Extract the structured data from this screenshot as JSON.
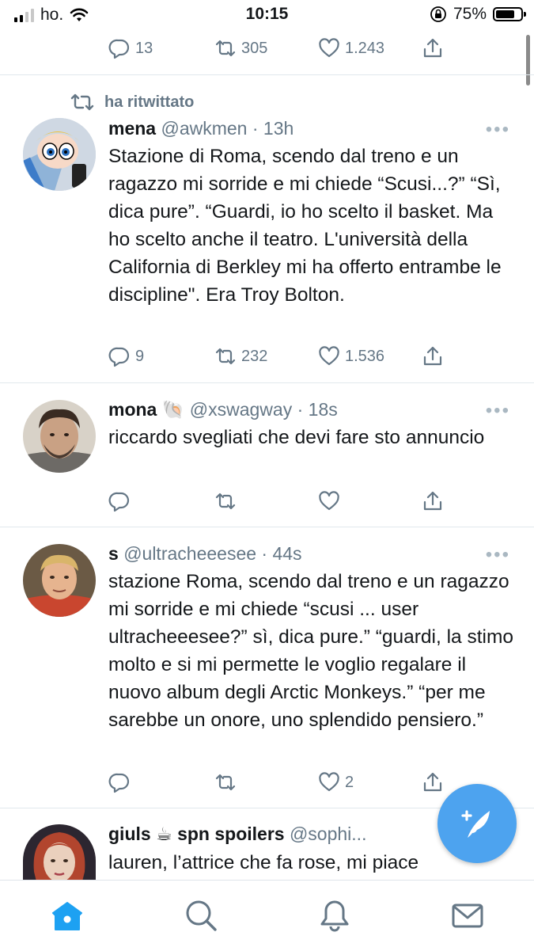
{
  "status": {
    "carrier": "ho.",
    "time": "10:15",
    "battery": "75%",
    "battery_level": 0.75,
    "icons": [
      "signal-icon",
      "wifi-icon",
      "orientation-lock-icon",
      "battery-icon"
    ]
  },
  "top_actions": {
    "replies": "13",
    "retweets": "305",
    "likes": "1.243"
  },
  "tweets": [
    {
      "retweeted_by": "ha ritwittato",
      "name": "mena",
      "handle": "@awkmen · 13h",
      "more": "•••",
      "text": "Stazione di Roma, scendo dal treno e un ragazzo mi sorride e mi chiede “Scusi...?” “Sì, dica pure”. “Guardi, io ho scelto il basket. Ma ho scelto anche il teatro. L'università della California di Berkley mi ha offerto entrambe le discipline\". Era Troy Bolton.",
      "replies": "9",
      "retweets": "232",
      "likes": "1.536"
    },
    {
      "name": "mona",
      "name_emoji": "🐚",
      "handle": "@xswagway · 18s",
      "more": "•••",
      "text": "riccardo svegliati che devi fare sto annuncio",
      "replies": "",
      "retweets": "",
      "likes": ""
    },
    {
      "name": "s",
      "handle": "@ultracheeesee · 44s",
      "more": "•••",
      "text": "stazione Roma, scendo dal treno e un ragazzo mi sorride e mi chiede “scusi ... user ultracheeesee?” sì, dica pure.” “guardi, la stimo molto e si mi permette le voglio regalare il nuovo album degli Arctic Monkeys.” “per me sarebbe un onore, uno splendido pensiero.”",
      "replies": "",
      "retweets": "",
      "likes": "2"
    },
    {
      "name": "giuls",
      "name_emoji": "☕",
      "name_suffix": "spn spoilers",
      "handle": "@sophi...",
      "text": "lauren, l’attrice che fa rose, mi piace"
    }
  ],
  "fab": {
    "icon": "compose-tweet-icon"
  },
  "tabbar": [
    "home-icon",
    "search-icon",
    "notifications-icon",
    "messages-icon"
  ],
  "colors": {
    "accent": "#1da1f2",
    "fab": "#4da3ef",
    "secondary_text": "#657786"
  }
}
